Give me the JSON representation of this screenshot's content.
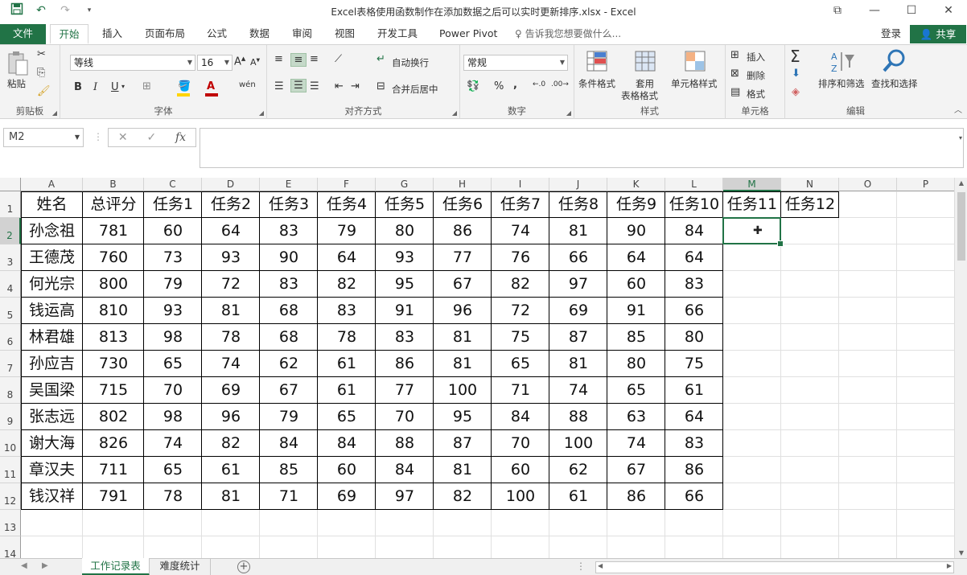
{
  "window": {
    "title": "Excel表格使用函数制作在添加数据之后可以实时更新排序.xlsx - Excel"
  },
  "tabs": {
    "file": "文件",
    "items": [
      "开始",
      "插入",
      "页面布局",
      "公式",
      "数据",
      "审阅",
      "视图",
      "开发工具",
      "Power Pivot"
    ],
    "tell_me": "告诉我您想要做什么...",
    "login": "登录",
    "share": "共享"
  },
  "ribbon": {
    "clipboard": {
      "label": "剪贴板",
      "paste": "粘贴"
    },
    "font": {
      "label": "字体",
      "name": "等线",
      "size": "16",
      "bold": "B",
      "italic": "I",
      "underline": "U",
      "phonetic": "wén"
    },
    "alignment": {
      "label": "对齐方式",
      "wrap": "自动换行",
      "merge": "合并后居中"
    },
    "number": {
      "label": "数字",
      "format": "常规",
      "percent": "%",
      "comma": ","
    },
    "styles": {
      "label": "样式",
      "conditional": "条件格式",
      "table1": "套用",
      "table2": "表格格式",
      "cell_styles": "单元格样式"
    },
    "cells": {
      "label": "单元格",
      "insert": "插入",
      "delete": "删除",
      "format": "格式"
    },
    "editing": {
      "label": "编辑",
      "sort": "排序和筛选",
      "find": "查找和选择"
    }
  },
  "formula_bar": {
    "name_box": "M2",
    "fx": "fx",
    "content": ""
  },
  "columns": [
    "A",
    "B",
    "C",
    "D",
    "E",
    "F",
    "G",
    "H",
    "I",
    "J",
    "K",
    "L",
    "M",
    "N",
    "O",
    "P"
  ],
  "rows": [
    "1",
    "2",
    "3",
    "4",
    "5",
    "6",
    "7",
    "8",
    "9",
    "10",
    "11",
    "12",
    "13",
    "14"
  ],
  "table": {
    "headers": [
      "姓名",
      "总评分",
      "任务1",
      "任务2",
      "任务3",
      "任务4",
      "任务5",
      "任务6",
      "任务7",
      "任务8",
      "任务9",
      "任务10",
      "任务11",
      "任务12"
    ],
    "rows": [
      [
        "孙念祖",
        "781",
        "60",
        "64",
        "83",
        "79",
        "80",
        "86",
        "74",
        "81",
        "90",
        "84"
      ],
      [
        "王德茂",
        "760",
        "73",
        "93",
        "90",
        "64",
        "93",
        "77",
        "76",
        "66",
        "64",
        "64"
      ],
      [
        "何光宗",
        "800",
        "79",
        "72",
        "83",
        "82",
        "95",
        "67",
        "82",
        "97",
        "60",
        "83"
      ],
      [
        "钱运高",
        "810",
        "93",
        "81",
        "68",
        "83",
        "91",
        "96",
        "72",
        "69",
        "91",
        "66"
      ],
      [
        "林君雄",
        "813",
        "98",
        "78",
        "68",
        "78",
        "83",
        "81",
        "75",
        "87",
        "85",
        "80"
      ],
      [
        "孙应吉",
        "730",
        "65",
        "74",
        "62",
        "61",
        "86",
        "81",
        "65",
        "81",
        "80",
        "75"
      ],
      [
        "吴国梁",
        "715",
        "70",
        "69",
        "67",
        "61",
        "77",
        "100",
        "71",
        "74",
        "65",
        "61"
      ],
      [
        "张志远",
        "802",
        "98",
        "96",
        "79",
        "65",
        "70",
        "95",
        "84",
        "88",
        "63",
        "64"
      ],
      [
        "谢大海",
        "826",
        "74",
        "82",
        "84",
        "84",
        "88",
        "87",
        "70",
        "100",
        "74",
        "83"
      ],
      [
        "章汉夫",
        "711",
        "65",
        "61",
        "85",
        "60",
        "84",
        "81",
        "60",
        "62",
        "67",
        "86"
      ],
      [
        "钱汉祥",
        "791",
        "78",
        "81",
        "71",
        "69",
        "97",
        "82",
        "100",
        "61",
        "86",
        "66"
      ]
    ]
  },
  "selected_cell": {
    "column": "M",
    "row": "2"
  },
  "sheets": {
    "items": [
      "工作记录表",
      "难度统计"
    ],
    "active": "工作记录表"
  },
  "colors": {
    "accent": "#217346"
  }
}
